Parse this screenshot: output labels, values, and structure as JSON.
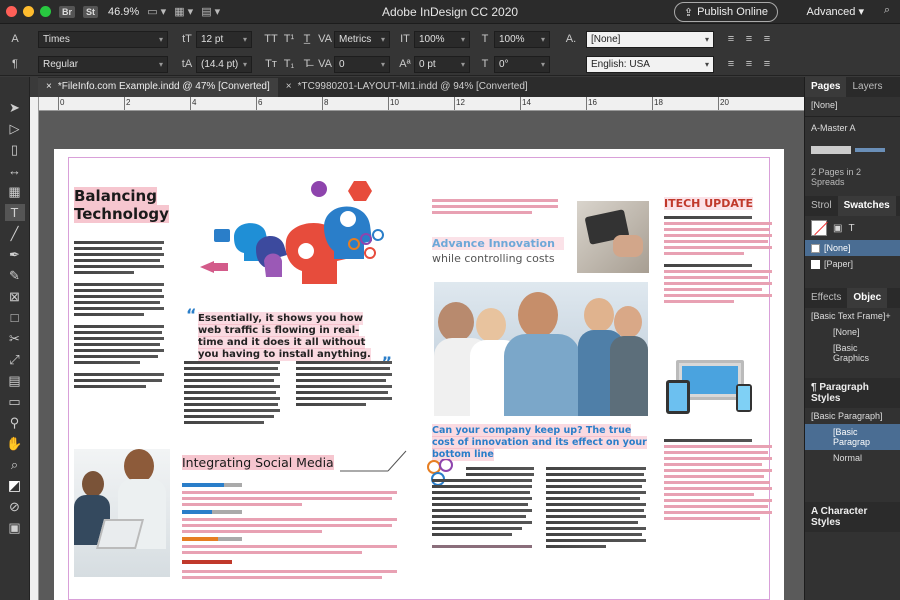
{
  "window": {
    "title": "Adobe InDesign CC 2020",
    "zoom": "46.9%",
    "app_badges": [
      "Br",
      "St"
    ],
    "publish_label": "Publish Online",
    "workspace_label": "Advanced"
  },
  "control": {
    "font_family": "Times",
    "font_style": "Regular",
    "font_size": "12 pt",
    "leading": "(14.4 pt)",
    "kerning": "Metrics",
    "tracking": "0",
    "vscale": "100%",
    "hscale": "100%",
    "baseline": "0 pt",
    "skew": "0°",
    "char_style": "[None]",
    "language": "English: USA"
  },
  "tabs": [
    {
      "label": "*FileInfo.com Example.indd @ 47% [Converted]",
      "active": true
    },
    {
      "label": "*TC9980201-LAYOUT-MI1.indd @ 94% [Converted]",
      "active": false
    }
  ],
  "ruler": {
    "labels": [
      "0",
      "2",
      "4",
      "6",
      "8",
      "10",
      "12",
      "14",
      "16",
      "18",
      "20"
    ]
  },
  "document": {
    "heading_balancing_1": "Balancing",
    "heading_balancing_2": "Technology",
    "quote": "Essentially, it shows you how web traffic is flowing in real-time and it does it all without you having to install anything.",
    "heading_advance": "Advance Innovation",
    "subheading_advance": "while controlling costs",
    "heading_tech_update": "ITECH UPDATE",
    "caption_company": "Can your company keep up? The true cost of innovation and its effect on your bottom line",
    "heading_social": "Integrating Social Media"
  },
  "panels": {
    "pages_tab": "Pages",
    "layers_tab": "Layers",
    "pages_none": "[None]",
    "pages_master": "A-Master A",
    "pages_summary": "2 Pages in 2 Spreads",
    "stroke_tab": "Strol",
    "swatches_tab": "Swatches",
    "swatch_none": "[None]",
    "swatch_paper": "[Paper]",
    "effects_tab": "Effects",
    "object_tab": "Objec",
    "obj_basic_text": "[Basic Text Frame]+",
    "obj_none": "[None]",
    "obj_basic_graphics": "[Basic Graphics",
    "para_styles_head": "Paragraph Styles",
    "para_basic": "[Basic Paragraph]",
    "para_basic_sel": "[Basic Paragrap",
    "para_normal": "Normal",
    "char_styles_head": "Character Styles"
  },
  "colors": {
    "accent_select": "#4a6d93",
    "highlight_pink": "#f6c6cf",
    "brand_blue": "#2a7ec9",
    "tech_update_red": "#c0392b"
  }
}
